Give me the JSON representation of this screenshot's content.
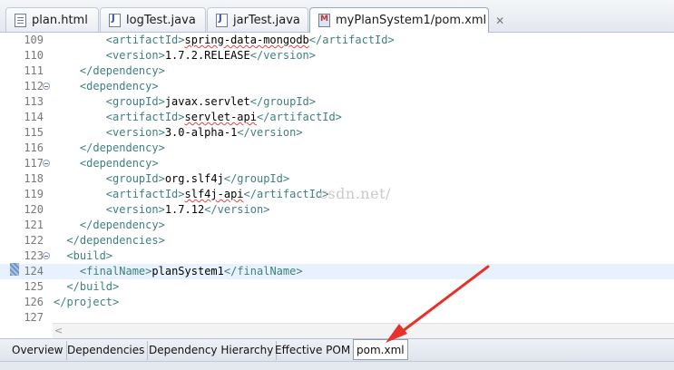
{
  "tabs": [
    {
      "label": "plan.html",
      "icon": "html-file-icon"
    },
    {
      "label": "logTest.java",
      "icon": "java-file-icon"
    },
    {
      "label": "jarTest.java",
      "icon": "java-file-icon"
    },
    {
      "label": "myPlanSystem1/pom.xml",
      "icon": "maven-pom-icon",
      "active": true
    }
  ],
  "editor": {
    "lines": [
      {
        "num": "109",
        "indent": "        ",
        "parts": [
          [
            "tag",
            "<artifactId>"
          ],
          [
            "txt",
            "spring-data-mongodb",
            true
          ],
          [
            "tag",
            "</artifactId>"
          ]
        ]
      },
      {
        "num": "110",
        "indent": "        ",
        "parts": [
          [
            "tag",
            "<version>"
          ],
          [
            "txt",
            "1.7.2.RELEASE"
          ],
          [
            "tag",
            "</version>"
          ]
        ]
      },
      {
        "num": "111",
        "indent": "    ",
        "parts": [
          [
            "tag",
            "</dependency>"
          ]
        ]
      },
      {
        "num": "112",
        "fold": true,
        "indent": "    ",
        "parts": [
          [
            "tag",
            "<dependency>"
          ]
        ]
      },
      {
        "num": "113",
        "indent": "        ",
        "parts": [
          [
            "tag",
            "<groupId>"
          ],
          [
            "txt",
            "javax.servlet"
          ],
          [
            "tag",
            "</groupId>"
          ]
        ]
      },
      {
        "num": "114",
        "indent": "        ",
        "parts": [
          [
            "tag",
            "<artifactId>"
          ],
          [
            "txt",
            "servlet-api",
            true
          ],
          [
            "tag",
            "</artifactId>"
          ]
        ]
      },
      {
        "num": "115",
        "indent": "        ",
        "parts": [
          [
            "tag",
            "<version>"
          ],
          [
            "txt",
            "3.0-alpha-1"
          ],
          [
            "tag",
            "</version>"
          ]
        ]
      },
      {
        "num": "116",
        "indent": "    ",
        "parts": [
          [
            "tag",
            "</dependency>"
          ]
        ]
      },
      {
        "num": "117",
        "fold": true,
        "indent": "    ",
        "parts": [
          [
            "tag",
            "<dependency>"
          ]
        ]
      },
      {
        "num": "118",
        "indent": "        ",
        "parts": [
          [
            "tag",
            "<groupId>"
          ],
          [
            "txt",
            "org.slf4j"
          ],
          [
            "tag",
            "</groupId>"
          ]
        ]
      },
      {
        "num": "119",
        "indent": "        ",
        "parts": [
          [
            "tag",
            "<artifactId>"
          ],
          [
            "txt",
            "slf4j-api",
            true
          ],
          [
            "tag",
            "</artifactId>"
          ]
        ]
      },
      {
        "num": "120",
        "indent": "        ",
        "parts": [
          [
            "tag",
            "<version>"
          ],
          [
            "txt",
            "1.7.12"
          ],
          [
            "tag",
            "</version>"
          ]
        ]
      },
      {
        "num": "121",
        "indent": "    ",
        "parts": [
          [
            "tag",
            "</dependency>"
          ]
        ]
      },
      {
        "num": "122",
        "indent": "  ",
        "parts": [
          [
            "tag",
            "</dependencies>"
          ]
        ]
      },
      {
        "num": "123",
        "fold": true,
        "indent": "  ",
        "parts": [
          [
            "tag",
            "<build>"
          ]
        ]
      },
      {
        "num": "124",
        "highlight": true,
        "indent": "    ",
        "parts": [
          [
            "tag",
            "<finalName>"
          ],
          [
            "txt",
            "planSystem1"
          ],
          [
            "tag",
            "</finalName>"
          ]
        ]
      },
      {
        "num": "125",
        "indent": "  ",
        "parts": [
          [
            "tag",
            "</build>"
          ]
        ]
      },
      {
        "num": "126",
        "indent": "",
        "parts": [
          [
            "tag",
            "</project>"
          ]
        ]
      },
      {
        "num": "127",
        "indent": "",
        "parts": []
      }
    ],
    "watermark": "csdn.net/"
  },
  "page_tabs": [
    "Overview",
    "Dependencies",
    "Dependency Hierarchy",
    "Effective POM",
    "pom.xml"
  ],
  "active_page_tab": "pom.xml",
  "colors": {
    "tag": "#3f7f7f",
    "highlight_line": "#e8f2fe",
    "annotation_arrow": "#e8312b"
  }
}
